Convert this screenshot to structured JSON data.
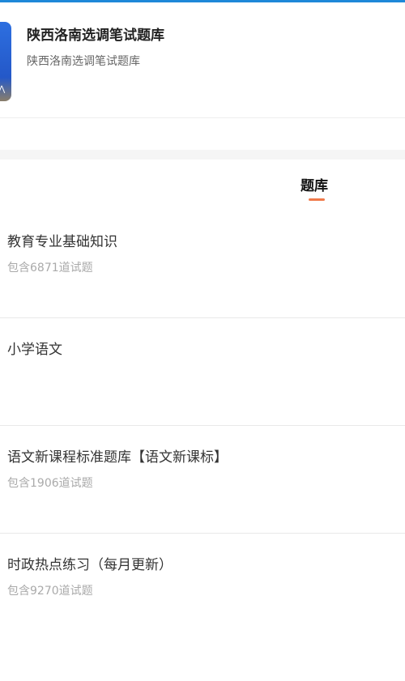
{
  "colors": {
    "accent_bar": "#1e88d8",
    "tab_underline": "#f07a4a"
  },
  "header": {
    "title": "陕西洛南选调笔试题库",
    "subtitle": "陕西洛南选调笔试题库"
  },
  "tabs": [
    {
      "label": "题库",
      "active": true
    }
  ],
  "question_banks": [
    {
      "name": "教育专业基础知识",
      "count_text": "包含6871道试题"
    },
    {
      "name": "小学语文",
      "count_text": ""
    },
    {
      "name": "语文新课程标准题库【语文新课标】",
      "count_text": "包含1906道试题"
    },
    {
      "name": "时政热点练习（每月更新）",
      "count_text": "包含9270道试题"
    }
  ]
}
